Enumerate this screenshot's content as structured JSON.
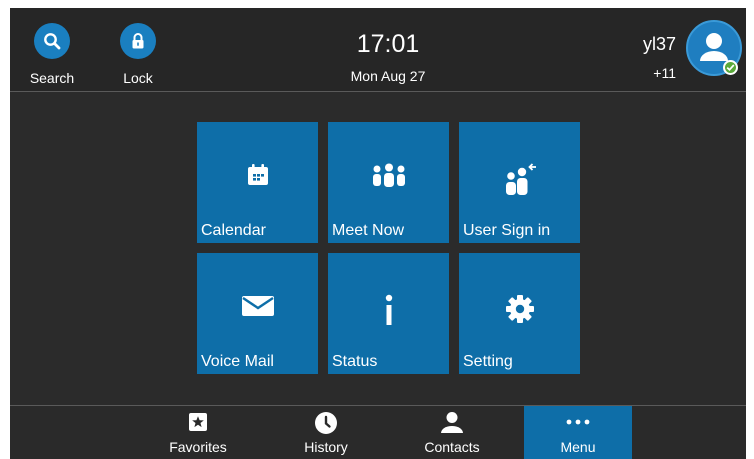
{
  "header": {
    "search_label": "Search",
    "lock_label": "Lock",
    "time": "17:01",
    "date": "Mon Aug 27",
    "account_name": "yl37",
    "account_count": "+11",
    "presence_status_color": "#5aa93a"
  },
  "tiles": [
    {
      "label": "Calendar",
      "icon": "calendar-icon"
    },
    {
      "label": "Meet Now",
      "icon": "group-icon"
    },
    {
      "label": "User Sign in",
      "icon": "user-sign-in-icon"
    },
    {
      "label": "Voice Mail",
      "icon": "envelope-icon"
    },
    {
      "label": "Status",
      "icon": "info-icon"
    },
    {
      "label": "Setting",
      "icon": "gear-icon"
    }
  ],
  "nav": {
    "items": [
      {
        "label": "Favorites",
        "icon": "star-icon"
      },
      {
        "label": "History",
        "icon": "clock-icon"
      },
      {
        "label": "Contacts",
        "icon": "person-icon"
      },
      {
        "label": "Menu",
        "icon": "more-icon",
        "selected": true
      }
    ]
  },
  "colors": {
    "accent": "#0e6ea8",
    "button_circle": "#1a7fc0",
    "background": "#2b2b2b"
  }
}
